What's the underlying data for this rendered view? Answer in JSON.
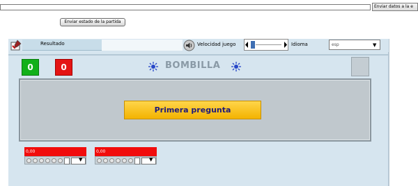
{
  "top": {
    "send_data_label": "Enviar datos a la e",
    "send_state_label": "Enviar estado de la partida"
  },
  "toolbar": {
    "results_label": "Resultado",
    "speed_label": "Velocidad juego",
    "language_label": "Idioma",
    "language_value": "esp"
  },
  "score": {
    "correct": "0",
    "wrong": "0"
  },
  "game": {
    "title": "BOMBILLA",
    "first_question_label": "Primera pregunta"
  },
  "players": [
    {
      "value": "0,00"
    },
    {
      "value": "0,00"
    }
  ],
  "colors": {
    "game_bg": "#d6e5ef",
    "score_green": "#12b01a",
    "score_red": "#e41414",
    "button_yellow": "#f3b300",
    "player_red": "#f10c0c"
  },
  "icons": {
    "results": "checklist-pen-icon",
    "speaker": "speaker-icon",
    "title_left": "bulb-spark-icon",
    "title_right": "bulb-spark-icon"
  }
}
